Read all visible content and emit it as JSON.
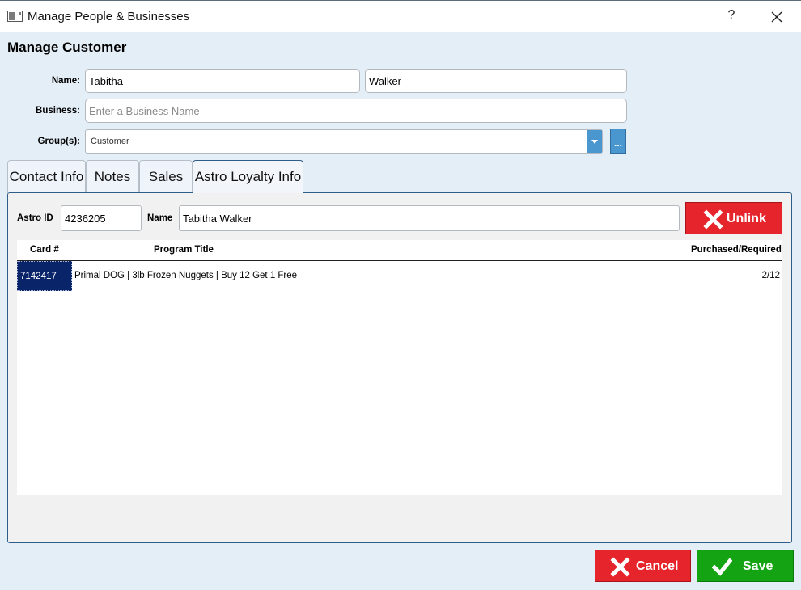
{
  "window": {
    "title": "Manage People & Businesses",
    "help_label": "?"
  },
  "heading": "Manage Customer",
  "form": {
    "name_label": "Name:",
    "first_name": "Tabitha",
    "last_name": "Walker",
    "business_label": "Business:",
    "business_value": "",
    "business_placeholder": "Enter a Business Name",
    "groups_label": "Group(s):",
    "groups_value": "Customer",
    "more_label": "..."
  },
  "tabs": [
    {
      "label": "Contact Info"
    },
    {
      "label": "Notes"
    },
    {
      "label": "Sales"
    },
    {
      "label": "Astro Loyalty Info",
      "active": true
    }
  ],
  "astro": {
    "id_label": "Astro ID",
    "id_value": "4236205",
    "name_label": "Name",
    "name_value": "Tabitha Walker",
    "unlink_label": "Unlink"
  },
  "table": {
    "headers": {
      "card": "Card #",
      "program": "Program Title",
      "purchased": "Purchased/Required"
    },
    "rows": [
      {
        "card": "7142417",
        "program": "Primal DOG | 3lb Frozen Nuggets | Buy 12 Get 1 Free",
        "purchased": "2/12"
      }
    ]
  },
  "footer": {
    "cancel_label": "Cancel",
    "save_label": "Save"
  },
  "colors": {
    "accent": "#4a97cf",
    "danger": "#e5242c",
    "success": "#13a313",
    "selection": "#0a246a"
  }
}
